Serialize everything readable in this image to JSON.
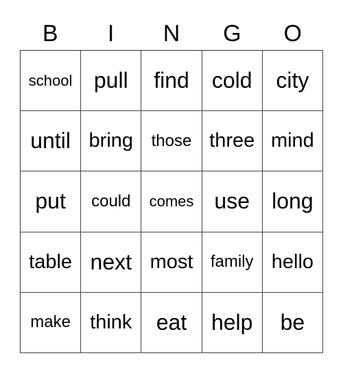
{
  "header": [
    "B",
    "I",
    "N",
    "G",
    "O"
  ],
  "cells": [
    [
      "school",
      "pull",
      "find",
      "cold",
      "city"
    ],
    [
      "until",
      "bring",
      "those",
      "three",
      "mind"
    ],
    [
      "put",
      "could",
      "comes",
      "use",
      "long"
    ],
    [
      "table",
      "next",
      "most",
      "family",
      "hello"
    ],
    [
      "make",
      "think",
      "eat",
      "help",
      "be"
    ]
  ]
}
